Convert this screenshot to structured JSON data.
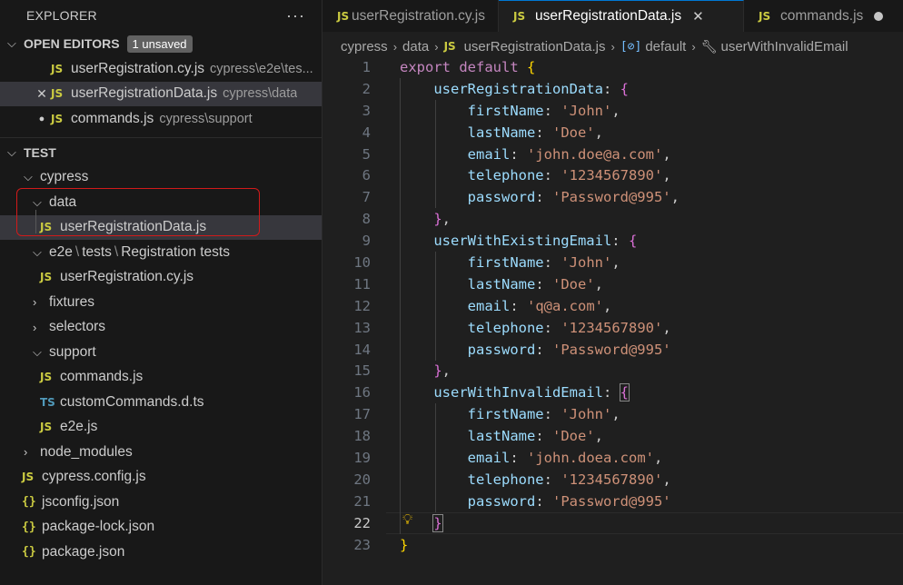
{
  "sidebar": {
    "title": "EXPLORER",
    "more_icon": "ellipsis-icon",
    "open_editors": {
      "label": "OPEN EDITORS",
      "badge": "1 unsaved",
      "items": [
        {
          "name": "userRegistration.cy.js",
          "path": "cypress\\e2e\\tes...",
          "icon": "js",
          "state": ""
        },
        {
          "name": "userRegistrationData.js",
          "path": "cypress\\data",
          "icon": "js",
          "state": "close"
        },
        {
          "name": "commands.js",
          "path": "cypress\\support",
          "icon": "js",
          "state": "unsaved"
        }
      ]
    },
    "workspace": {
      "label": "TEST",
      "tree": {
        "cypress": "cypress",
        "data": "data",
        "data_file": "userRegistrationData.js",
        "e2e_parts": [
          "e2e",
          "tests",
          "Registration tests"
        ],
        "e2e_file": "userRegistration.cy.js",
        "fixtures": "fixtures",
        "selectors": "selectors",
        "support": "support",
        "support_files": [
          "commands.js",
          "customCommands.d.ts",
          "e2e.js"
        ],
        "node_modules": "node_modules",
        "root_files": [
          "cypress.config.js",
          "jsconfig.json",
          "package-lock.json",
          "package.json"
        ]
      }
    }
  },
  "icons": {
    "js": "JS",
    "ts": "TS",
    "json": "{}",
    "chevron_down": "⌄",
    "chevron_right": "›"
  },
  "tabs": [
    {
      "label": "userRegistration.cy.js",
      "active": false
    },
    {
      "label": "userRegistrationData.js",
      "active": true
    },
    {
      "label": "commands.js",
      "active": false,
      "unsaved": true
    }
  ],
  "breadcrumb": [
    "cypress",
    "data",
    "userRegistrationData.js",
    "default",
    "userWithInvalidEmail"
  ],
  "editor": {
    "current_line": 22,
    "lines": [
      {
        "n": "1"
      },
      {
        "n": "2"
      },
      {
        "n": "3"
      },
      {
        "n": "4"
      },
      {
        "n": "5"
      },
      {
        "n": "6"
      },
      {
        "n": "7"
      },
      {
        "n": "8"
      },
      {
        "n": "9"
      },
      {
        "n": "10"
      },
      {
        "n": "11"
      },
      {
        "n": "12"
      },
      {
        "n": "13"
      },
      {
        "n": "14"
      },
      {
        "n": "15"
      },
      {
        "n": "16"
      },
      {
        "n": "17"
      },
      {
        "n": "18"
      },
      {
        "n": "19"
      },
      {
        "n": "20"
      },
      {
        "n": "21"
      },
      {
        "n": "22"
      },
      {
        "n": "23"
      }
    ],
    "code": {
      "export": "export",
      "default": "default",
      "objects": [
        {
          "key": "userRegistrationData",
          "firstName": "'John'",
          "lastName": "'Doe'",
          "email": "'john.doe@a.com'",
          "telephone": "'1234567890'",
          "password": "'Password@995'",
          "trailing": ","
        },
        {
          "key": "userWithExistingEmail",
          "firstName": "'John'",
          "lastName": "'Doe'",
          "email": "'q@a.com'",
          "telephone": "'1234567890'",
          "password": "'Password@995'",
          "trailing": ""
        },
        {
          "key": "userWithInvalidEmail",
          "firstName": "'John'",
          "lastName": "'Doe'",
          "email": "'john.doea.com'",
          "telephone": "'1234567890'",
          "password": "'Password@995'",
          "trailing": ""
        }
      ],
      "fields": [
        "firstName",
        "lastName",
        "email",
        "telephone",
        "password"
      ]
    }
  },
  "colors": {
    "accent": "#0078d4",
    "highlight_box": "#d11a1a",
    "js_icon": "#cbcb41",
    "ts_icon": "#519aba"
  }
}
